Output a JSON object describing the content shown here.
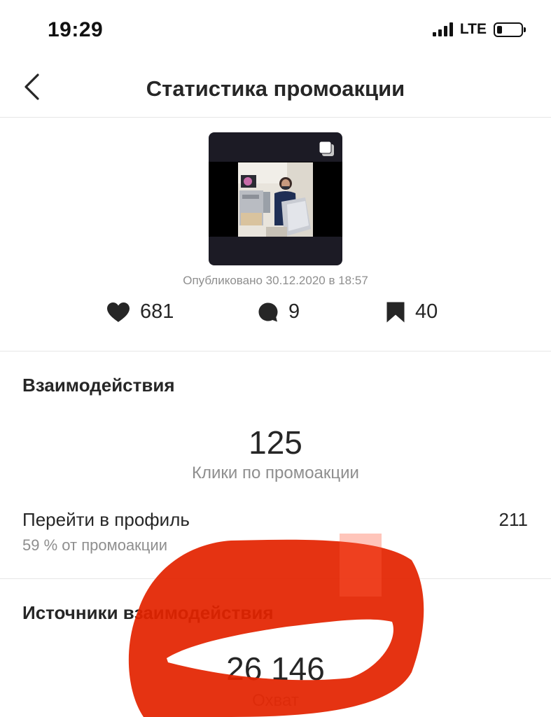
{
  "status_bar": {
    "time": "19:29",
    "network": "LTE",
    "signal_icon": "signal-bars-icon",
    "battery_icon": "battery-low-icon"
  },
  "nav": {
    "title": "Статистика промоакции",
    "back_icon": "chevron-left-icon"
  },
  "post": {
    "published": "Опубликовано 30.12.2020 в 18:57",
    "likes": "681",
    "comments": "9",
    "saves": "40",
    "icons": {
      "likes": "heart-icon",
      "comments": "comment-bubble-icon",
      "saves": "bookmark-icon",
      "carousel": "carousel-multiple-icon"
    }
  },
  "interactions": {
    "title": "Взаимодействия",
    "clicks_value": "125",
    "clicks_label": "Клики по промоакции",
    "profile_label": "Перейти в профиль",
    "profile_sub": "59 % от промоакции",
    "profile_value": "211"
  },
  "reach": {
    "title": "Источники взаимодействия",
    "value": "26 146",
    "label": "Охват"
  },
  "colors": {
    "text": "#262626",
    "secondary": "#8e8e8e",
    "divider": "#e6e6e6",
    "annotation": "#e32400"
  }
}
